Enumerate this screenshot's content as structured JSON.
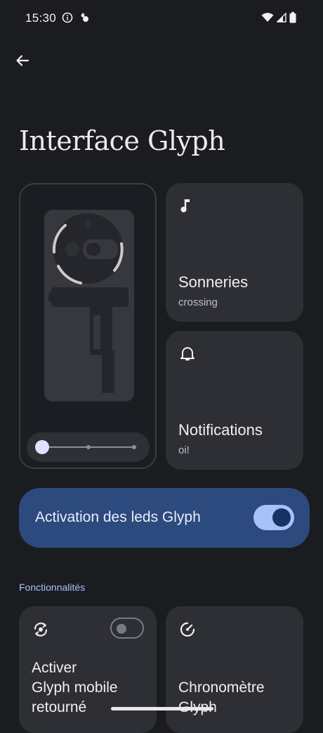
{
  "status_bar": {
    "time": "15:30",
    "left_icons": [
      "info-icon",
      "cat-icon"
    ],
    "right_icons": [
      "wifi-icon",
      "signal-icon",
      "battery-icon"
    ]
  },
  "header": {
    "back_icon": "arrow-back-icon",
    "title": "Interface Glyph"
  },
  "preview": {
    "slider_value": 0
  },
  "tiles": {
    "ringtones": {
      "icon": "music-note-icon",
      "title": "Sonneries",
      "subtitle": "crossing"
    },
    "notifications": {
      "icon": "bell-icon",
      "title": "Notifications",
      "subtitle": "oi!"
    }
  },
  "activation": {
    "label": "Activation des leds Glyph",
    "enabled": true
  },
  "features": {
    "section_title": "Fonctionnalités",
    "flip": {
      "icon": "flip-icon",
      "title_lines": [
        "Activer",
        "Glyph mobile",
        "retourné"
      ],
      "enabled": false
    },
    "stopwatch": {
      "icon": "stopwatch-icon",
      "title_lines": [
        "Chronomètre",
        "Glyph"
      ]
    }
  },
  "colors": {
    "background": "#1b1c20",
    "tile": "#2e2f35",
    "accent_card": "#2c4a7e",
    "accent_toggle": "#a7c1f9",
    "section_header": "#a9c3f5"
  }
}
